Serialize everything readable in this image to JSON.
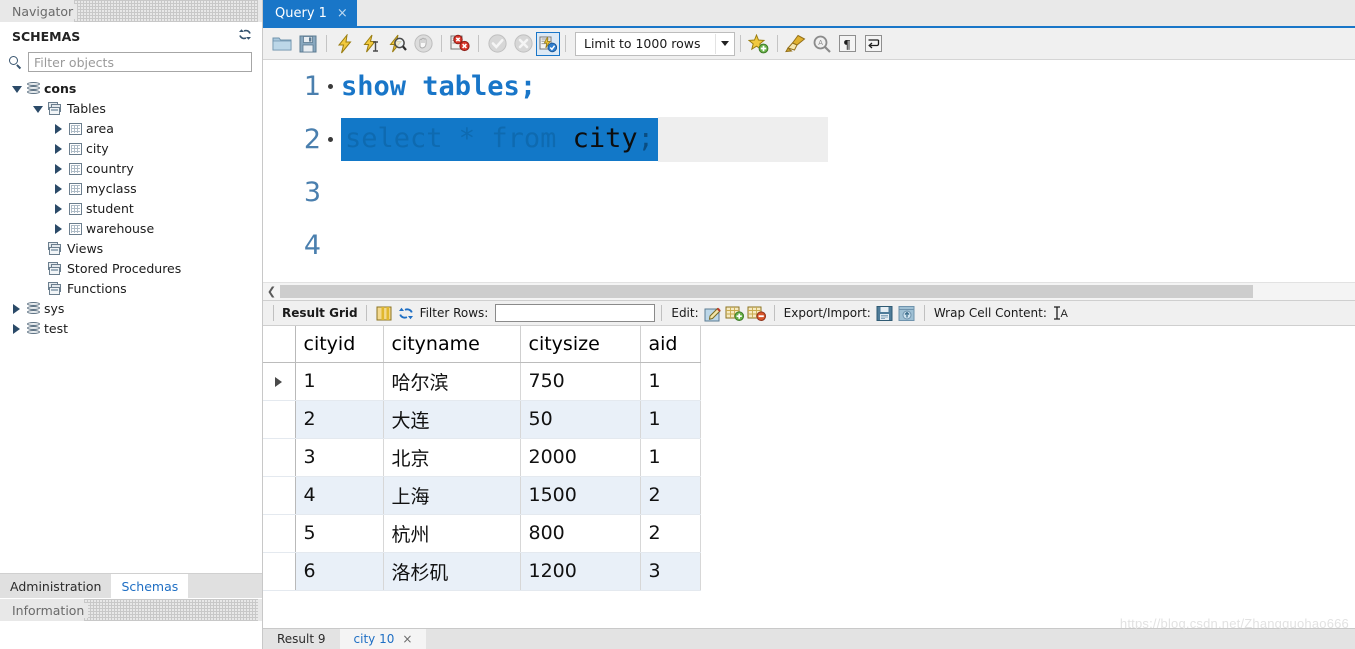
{
  "sidebar": {
    "navigator_title": "Navigator",
    "schemas_title": "SCHEMAS",
    "refresh_icon": "refresh-icon",
    "filter": {
      "placeholder": "Filter objects",
      "value": ""
    },
    "tree": [
      {
        "label": "cons",
        "icon": "database-icon",
        "expander": "down",
        "indent": 0,
        "bold": true
      },
      {
        "label": "Tables",
        "icon": "stack-icon",
        "expander": "down",
        "indent": 1,
        "bold": false
      },
      {
        "label": "area",
        "icon": "table-icon",
        "expander": "right",
        "indent": 2,
        "bold": false
      },
      {
        "label": "city",
        "icon": "table-icon",
        "expander": "right",
        "indent": 2,
        "bold": false
      },
      {
        "label": "country",
        "icon": "table-icon",
        "expander": "right",
        "indent": 2,
        "bold": false
      },
      {
        "label": "myclass",
        "icon": "table-icon",
        "expander": "right",
        "indent": 2,
        "bold": false
      },
      {
        "label": "student",
        "icon": "table-icon",
        "expander": "right",
        "indent": 2,
        "bold": false
      },
      {
        "label": "warehouse",
        "icon": "table-icon",
        "expander": "right",
        "indent": 2,
        "bold": false
      },
      {
        "label": "Views",
        "icon": "stack-icon",
        "expander": "none",
        "indent": 1,
        "bold": false
      },
      {
        "label": "Stored Procedures",
        "icon": "stack-icon",
        "expander": "none",
        "indent": 1,
        "bold": false
      },
      {
        "label": "Functions",
        "icon": "stack-icon",
        "expander": "none",
        "indent": 1,
        "bold": false
      },
      {
        "label": "sys",
        "icon": "database-icon",
        "expander": "right",
        "indent": 0,
        "bold": false
      },
      {
        "label": "test",
        "icon": "database-icon",
        "expander": "right",
        "indent": 0,
        "bold": false
      }
    ],
    "tabs": [
      {
        "label": "Administration",
        "active": false
      },
      {
        "label": "Schemas",
        "active": true
      }
    ],
    "information_title": "Information"
  },
  "editor_tabs": [
    {
      "label": "Query 1",
      "close": "×",
      "active": true
    }
  ],
  "toolbar": {
    "buttons": [
      {
        "name": "open-sql-script-icon",
        "title": "Open SQL Script"
      },
      {
        "name": "save-script-icon",
        "title": "Save Script"
      },
      {
        "name": "execute-statement-icon",
        "title": "Execute"
      },
      {
        "name": "execute-current-statement-icon",
        "title": "Execute Current Statement"
      },
      {
        "name": "explain-query-icon",
        "title": "Explain Query"
      },
      {
        "name": "stop-execution-icon",
        "title": "Stop"
      },
      {
        "name": "toggle-stop-on-error-icon",
        "title": "Toggle Stop On Error"
      },
      {
        "name": "commit-icon",
        "title": "Commit"
      },
      {
        "name": "rollback-icon",
        "title": "Rollback"
      },
      {
        "name": "autocommit-icon",
        "title": "Toggle Auto-Commit"
      }
    ],
    "limit": {
      "label": "Limit to 1000 rows",
      "caret": "dropdown-caret-icon"
    },
    "right_buttons": [
      {
        "name": "add-snippet-icon",
        "title": "Save snippet"
      },
      {
        "name": "beautify-sql-icon",
        "title": "Beautify SQL"
      },
      {
        "name": "find-icon",
        "title": "Find"
      },
      {
        "name": "toggle-invisible-chars-icon",
        "title": "Toggle invisible characters"
      },
      {
        "name": "toggle-wrapping-icon",
        "title": "Toggle wrapping"
      }
    ]
  },
  "editor": {
    "lines": [
      {
        "number": "1",
        "has_dot": true,
        "selected": false,
        "tokens": [
          {
            "text": "show tables",
            "type": "keyword"
          },
          {
            "text": ";",
            "type": "punct"
          }
        ]
      },
      {
        "number": "2",
        "has_dot": true,
        "selected": true,
        "tokens": [
          {
            "text": "select",
            "type": "sel-keyword"
          },
          {
            "text": " * ",
            "type": "sel-plain-dim"
          },
          {
            "text": "from",
            "type": "sel-keyword"
          },
          {
            "text": " city",
            "type": "sel-plain"
          },
          {
            "text": ";",
            "type": "sel-semi"
          }
        ]
      },
      {
        "number": "3",
        "has_dot": false,
        "selected": false,
        "tokens": []
      },
      {
        "number": "4",
        "has_dot": false,
        "selected": false,
        "tokens": []
      }
    ]
  },
  "result_toolbar": {
    "result_grid_label": "Result Grid",
    "grid-view-icon": "grid-view-icon",
    "refresh-icon": "refresh-grid-icon",
    "filter_rows_label": "Filter Rows:",
    "filter_rows_value": "",
    "edit_label": "Edit:",
    "edit_icons": [
      "edit-cell-icon",
      "insert-row-icon",
      "delete-row-icon"
    ],
    "export_import_label": "Export/Import:",
    "export_icons": [
      "export-recordset-icon",
      "import-recordset-icon"
    ],
    "wrap_label": "Wrap Cell Content:",
    "wrap_icon": "wrap-cell-icon"
  },
  "result_grid": {
    "columns": [
      "cityid",
      "cityname",
      "citysize",
      "aid"
    ],
    "rows": [
      {
        "marker": true,
        "cells": [
          "1",
          "哈尔滨",
          "750",
          "1"
        ]
      },
      {
        "marker": false,
        "cells": [
          "2",
          "大连",
          "50",
          "1"
        ]
      },
      {
        "marker": false,
        "cells": [
          "3",
          "北京",
          "2000",
          "1"
        ]
      },
      {
        "marker": false,
        "cells": [
          "4",
          "上海",
          "1500",
          "2"
        ]
      },
      {
        "marker": false,
        "cells": [
          "5",
          "杭州",
          "800",
          "2"
        ]
      },
      {
        "marker": false,
        "cells": [
          "6",
          "洛杉矶",
          "1200",
          "3"
        ]
      }
    ]
  },
  "result_tabs": [
    {
      "label": "Result 9",
      "active": false,
      "close": ""
    },
    {
      "label": "city 10",
      "active": true,
      "close": "×"
    }
  ],
  "watermark": "https://blog.csdn.net/Zhangguohao666",
  "colors": {
    "accent_blue": "#1976c8",
    "selection_blue": "#1278c8",
    "alt_row": "#e9f0f8",
    "toolbar_bg": "#f0f0f0",
    "panel_bg": "#e8e8e8"
  }
}
